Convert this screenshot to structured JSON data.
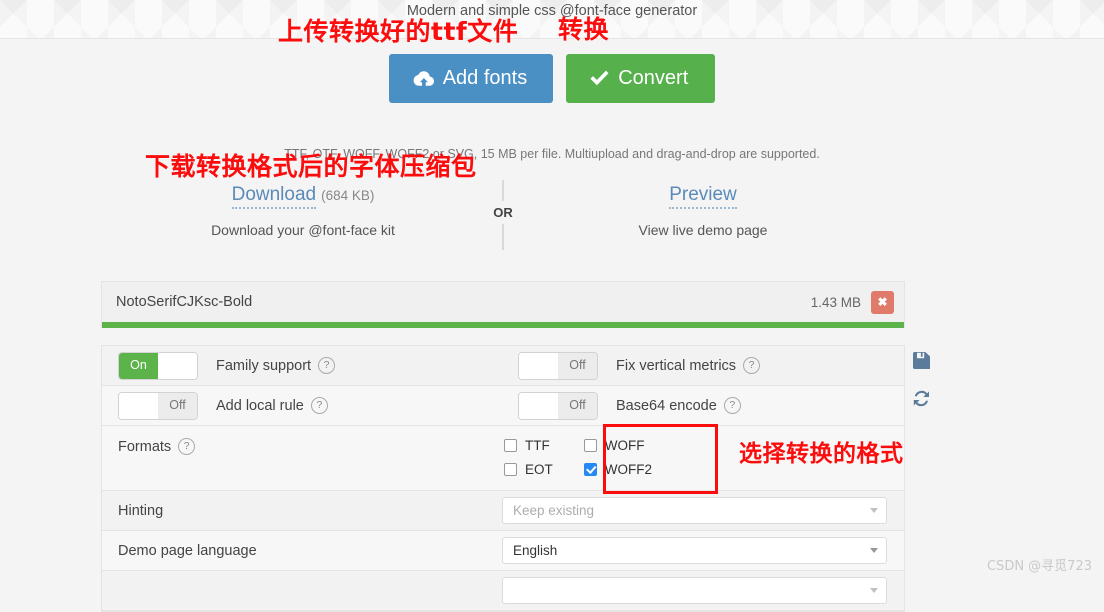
{
  "header": {
    "tagline": "Modern and simple css @font-face generator"
  },
  "annotations": {
    "upload": "上传转换好的ttf文件",
    "convert": "转换",
    "download": "下载转换格式后的字体压缩包",
    "formats": "选择转换的格式"
  },
  "actions": {
    "add_fonts_label": "Add fonts",
    "convert_label": "Convert",
    "hint": "TTF, OTF, WOFF, WOFF2 or SVG, 15 MB per file. Multiupload and drag-and-drop are supported."
  },
  "download_zone": {
    "download_label": "Download",
    "download_size": "(684 KB)",
    "download_sub": "Download your @font-face kit",
    "or_label": "OR",
    "preview_label": "Preview",
    "preview_sub": "View live demo page"
  },
  "file": {
    "name": "NotoSerifCJKsc-Bold",
    "size": "1.43 MB",
    "delete_label": "✖"
  },
  "options": {
    "toggles": [
      {
        "label": "Family support",
        "state": "On",
        "on": true
      },
      {
        "label": "Fix vertical metrics",
        "state": "Off",
        "on": false
      },
      {
        "label": "Add local rule",
        "state": "Off",
        "on": false
      },
      {
        "label": "Base64 encode",
        "state": "Off",
        "on": false
      }
    ],
    "formats_label": "Formats",
    "formats": [
      {
        "label": "TTF",
        "checked": false
      },
      {
        "label": "EOT",
        "checked": false
      },
      {
        "label": "WOFF",
        "checked": false
      },
      {
        "label": "WOFF2",
        "checked": true
      }
    ],
    "hinting_label": "Hinting",
    "hinting_value": "Keep existing",
    "demo_language_label": "Demo page language",
    "demo_language_value": "English",
    "help_marker": "?"
  },
  "side_icons": {
    "save": "save-icon",
    "reset": "refresh-icon"
  },
  "watermark": "CSDN @寻觅723",
  "colors": {
    "blue_button": "#4a90c4",
    "green_button": "#56b04b",
    "progress_green": "#5cb349",
    "checkbox_blue": "#2489f5",
    "annotation_red": "#fc0d0d",
    "delete_red": "#e07a6a"
  }
}
